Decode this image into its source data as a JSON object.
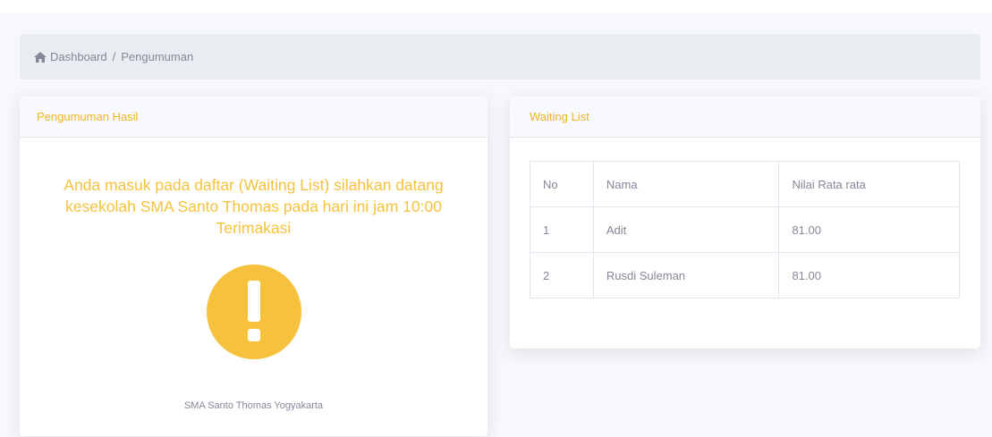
{
  "breadcrumb": {
    "home_icon": "home-icon",
    "home_label": "Dashboard",
    "separator": "/",
    "current": "Pengumuman"
  },
  "announcement_card": {
    "title": "Pengumuman Hasil",
    "message": "Anda masuk pada daftar (Waiting List) silahkan datang kesekolah SMA Santo Thomas pada hari ini jam 10:00 Terimakasi",
    "status_icon": "exclamation-circle-icon",
    "footer": "SMA Santo Thomas Yogyakarta"
  },
  "waiting_list": {
    "title": "Waiting List",
    "columns": [
      "No",
      "Nama",
      "Nilai Rata rata"
    ],
    "rows": [
      [
        "1",
        "Adit",
        "81.00"
      ],
      [
        "2",
        "Rusdi Suleman",
        "81.00"
      ]
    ]
  },
  "colors": {
    "accent": "#f6c23e",
    "header_text": "#f0b429",
    "muted_text": "#858796",
    "breadcrumb_bg": "#e9ecf1",
    "page_bg": "#f7f8fb"
  }
}
